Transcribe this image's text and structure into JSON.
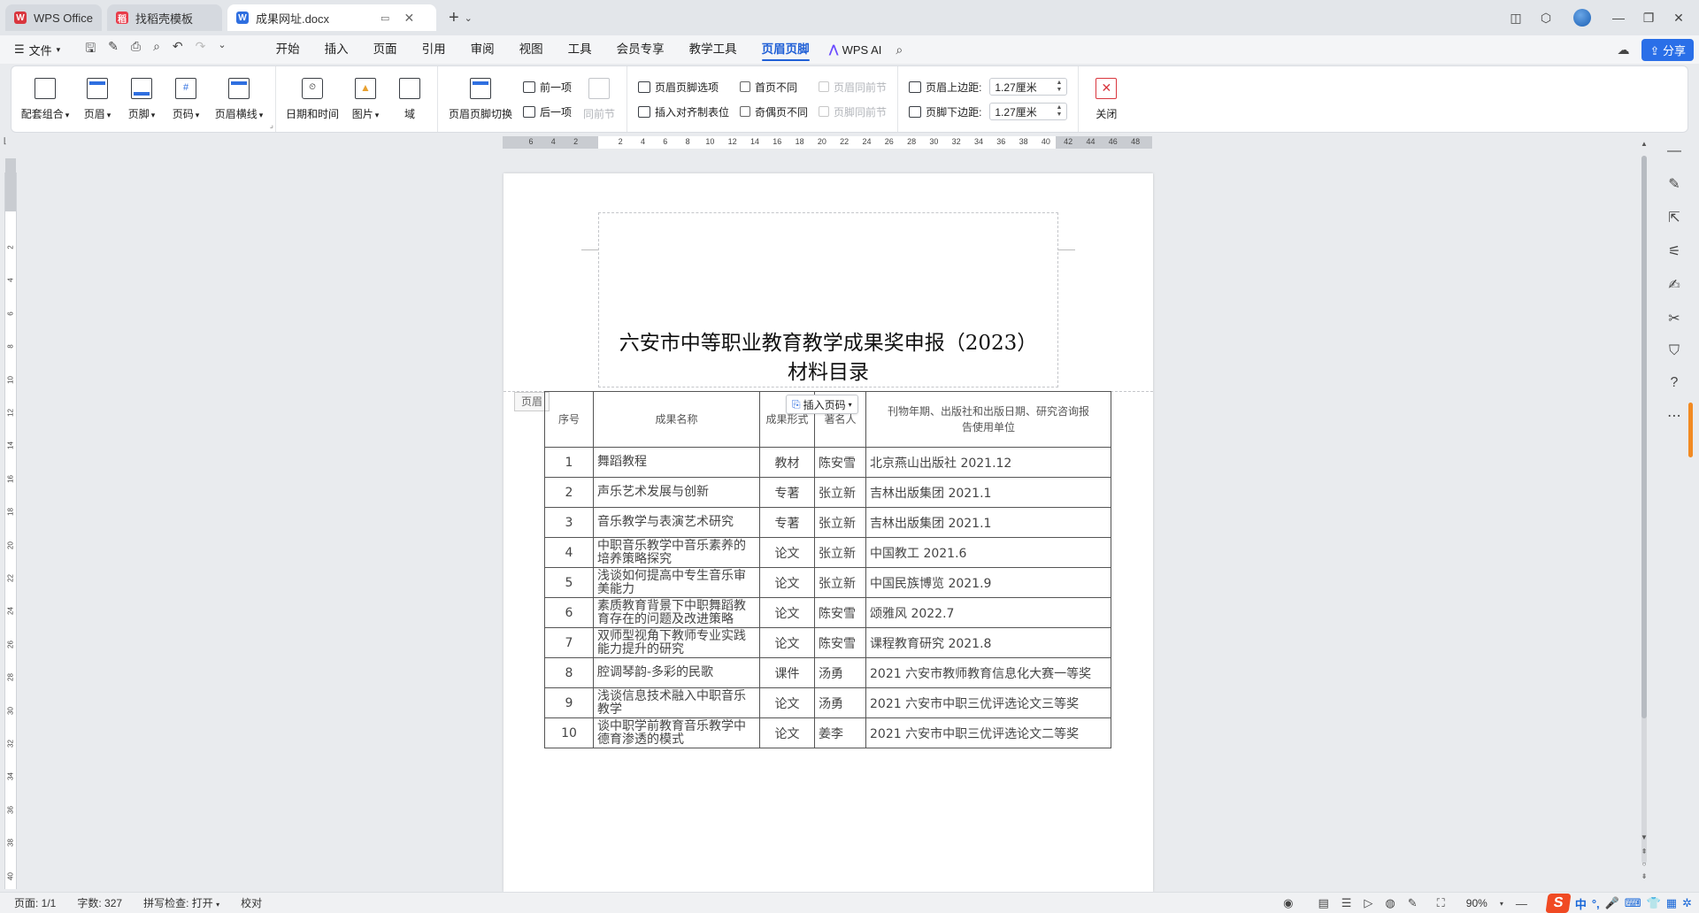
{
  "tabs": [
    {
      "label": "WPS Office",
      "icon": "wps-logo-icon",
      "color": "#d9363e"
    },
    {
      "label": "找稻壳模板",
      "icon": "docer-icon",
      "color": "#e83c4a"
    },
    {
      "label": "成果网址.docx",
      "icon": "word-doc-icon",
      "color": "#2f6fe0",
      "active": true
    }
  ],
  "menubar": {
    "file_label": "文件",
    "tabs": [
      "开始",
      "插入",
      "页面",
      "引用",
      "审阅",
      "视图",
      "工具",
      "会员专享",
      "教学工具",
      "页眉页脚"
    ],
    "active_tab": "页眉页脚",
    "wps_ai_label": "WPS AI",
    "share_label": "分享"
  },
  "ribbon": {
    "group1": [
      {
        "label": "配套组合",
        "dropdown": true
      },
      {
        "label": "页眉",
        "dropdown": true
      },
      {
        "label": "页脚",
        "dropdown": true
      },
      {
        "label": "页码",
        "dropdown": true
      },
      {
        "label": "页眉横线",
        "dropdown": true
      }
    ],
    "group2": [
      {
        "label": "日期和时间"
      },
      {
        "label": "图片",
        "dropdown": true
      },
      {
        "label": "域"
      }
    ],
    "switch_label": "页眉页脚切换",
    "prev_label": "前一项",
    "next_label": "后一项",
    "same_prev_label": "同前节",
    "options_label": "页眉页脚选项",
    "align_tab_label": "插入对齐制表位",
    "first_page_diff": "首页不同",
    "odd_even_diff": "奇偶页不同",
    "header_same_prev": "页眉同前节",
    "footer_same_prev": "页脚同前节",
    "header_top_label": "页眉上边距:",
    "header_top_value": "1.27厘米",
    "footer_bottom_label": "页脚下边距:",
    "footer_bottom_value": "1.27厘米",
    "close_label": "关闭"
  },
  "document": {
    "title_line1": "六安市中等职业教育教学成果奖申报（2023）",
    "title_line2": "材料目录",
    "header_tag": "页眉",
    "insert_page_number": "插入页码",
    "table": {
      "headers": [
        "序号",
        "成果名称",
        "成果形式",
        "著名人",
        "刊物年期、出版社和出版日期、研究咨询报告使用单位"
      ],
      "rows": [
        [
          "1",
          "舞蹈教程",
          "教材",
          "陈安雪",
          "北京燕山出版社 2021.12"
        ],
        [
          "2",
          "声乐艺术发展与创新",
          "专著",
          "张立新",
          "吉林出版集团 2021.1"
        ],
        [
          "3",
          "音乐教学与表演艺术研究",
          "专著",
          "张立新",
          "吉林出版集团 2021.1"
        ],
        [
          "4",
          "中职音乐教学中音乐素养的培养策略探究",
          "论文",
          "张立新",
          "中国教工 2021.6"
        ],
        [
          "5",
          "浅谈如何提高中专生音乐审美能力",
          "论文",
          "张立新",
          "中国民族博览 2021.9"
        ],
        [
          "6",
          "素质教育背景下中职舞蹈教育存在的问题及改进策略",
          "论文",
          "陈安雪",
          "颂雅风 2022.7"
        ],
        [
          "7",
          "双师型视角下教师专业实践能力提升的研究",
          "论文",
          "陈安雪",
          "课程教育研究 2021.8"
        ],
        [
          "8",
          "腔调琴韵-多彩的民歌",
          "课件",
          "汤勇",
          "2021 六安市教师教育信息化大赛一等奖"
        ],
        [
          "9",
          "浅谈信息技术融入中职音乐教学",
          "论文",
          "汤勇",
          "2021 六安市中职三优评选论文三等奖"
        ],
        [
          "10",
          "谈中职学前教育音乐教学中德育渗透的模式",
          "论文",
          "姜李",
          "2021 六安市中职三优评选论文二等奖"
        ]
      ]
    }
  },
  "ruler": {
    "h_ticks": [
      "6",
      "4",
      "2",
      "",
      "2",
      "4",
      "6",
      "8",
      "10",
      "12",
      "14",
      "16",
      "18",
      "20",
      "22",
      "24",
      "26",
      "28",
      "30",
      "32",
      "34",
      "36",
      "38",
      "40",
      "42",
      "44",
      "46",
      "48"
    ],
    "v_ticks": [
      "2",
      "4",
      "6",
      "8",
      "10",
      "12",
      "14",
      "16",
      "18",
      "20",
      "22",
      "24",
      "26",
      "28",
      "30",
      "32",
      "34",
      "36",
      "38",
      "40"
    ]
  },
  "status": {
    "page": "页面: 1/1",
    "words": "字数: 327",
    "spell": "拼写检查: 打开",
    "proof": "校对",
    "zoom": "90%"
  },
  "ime": {
    "logo": "S",
    "lang": "中"
  }
}
